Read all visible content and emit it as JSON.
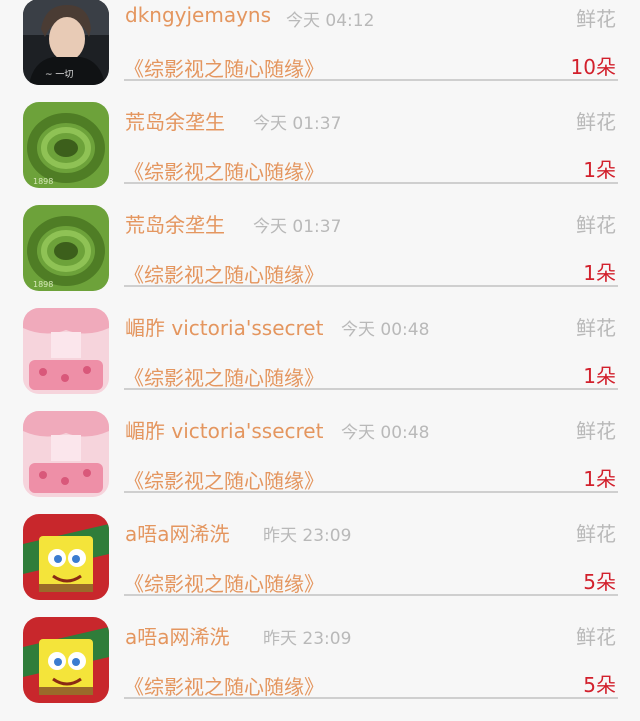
{
  "records": [
    {
      "user": "dkngyjemayns",
      "time": "今天 04:12",
      "gift_label": "鲜花",
      "work_title": "《综影视之随心随缘》",
      "count": "10朵",
      "avatar": "boy-photo"
    },
    {
      "user": "荒岛余垄生",
      "time": "今天 01:37",
      "gift_label": "鲜花",
      "work_title": "《综影视之随心随缘》",
      "count": "1朵",
      "avatar": "green-ring"
    },
    {
      "user": "荒岛余垄生",
      "time": "今天 01:37",
      "gift_label": "鲜花",
      "work_title": "《综影视之随心随缘》",
      "count": "1朵",
      "avatar": "green-ring"
    },
    {
      "user": "嵋胙 victoria'ssecret",
      "time": "今天 00:48",
      "gift_label": "鲜花",
      "work_title": "《综影视之随心随缘》",
      "count": "1朵",
      "avatar": "pink-bedroom"
    },
    {
      "user": "嵋胙 victoria'ssecret",
      "time": "今天 00:48",
      "gift_label": "鲜花",
      "work_title": "《综影视之随心随缘》",
      "count": "1朵",
      "avatar": "pink-bedroom"
    },
    {
      "user": "a唔a网浠洗",
      "time": "昨天 23:09",
      "gift_label": "鲜花",
      "work_title": "《综影视之随心随缘》",
      "count": "5朵",
      "avatar": "spongebob"
    },
    {
      "user": "a唔a网浠洗",
      "time": "昨天 23:09",
      "gift_label": "鲜花",
      "work_title": "《综影视之随心随缘》",
      "count": "5朵",
      "avatar": "spongebob"
    }
  ],
  "colors": {
    "name": "#e4965f",
    "count": "#d2202c",
    "muted": "#b9b9b9",
    "background": "#f7f7f7"
  }
}
